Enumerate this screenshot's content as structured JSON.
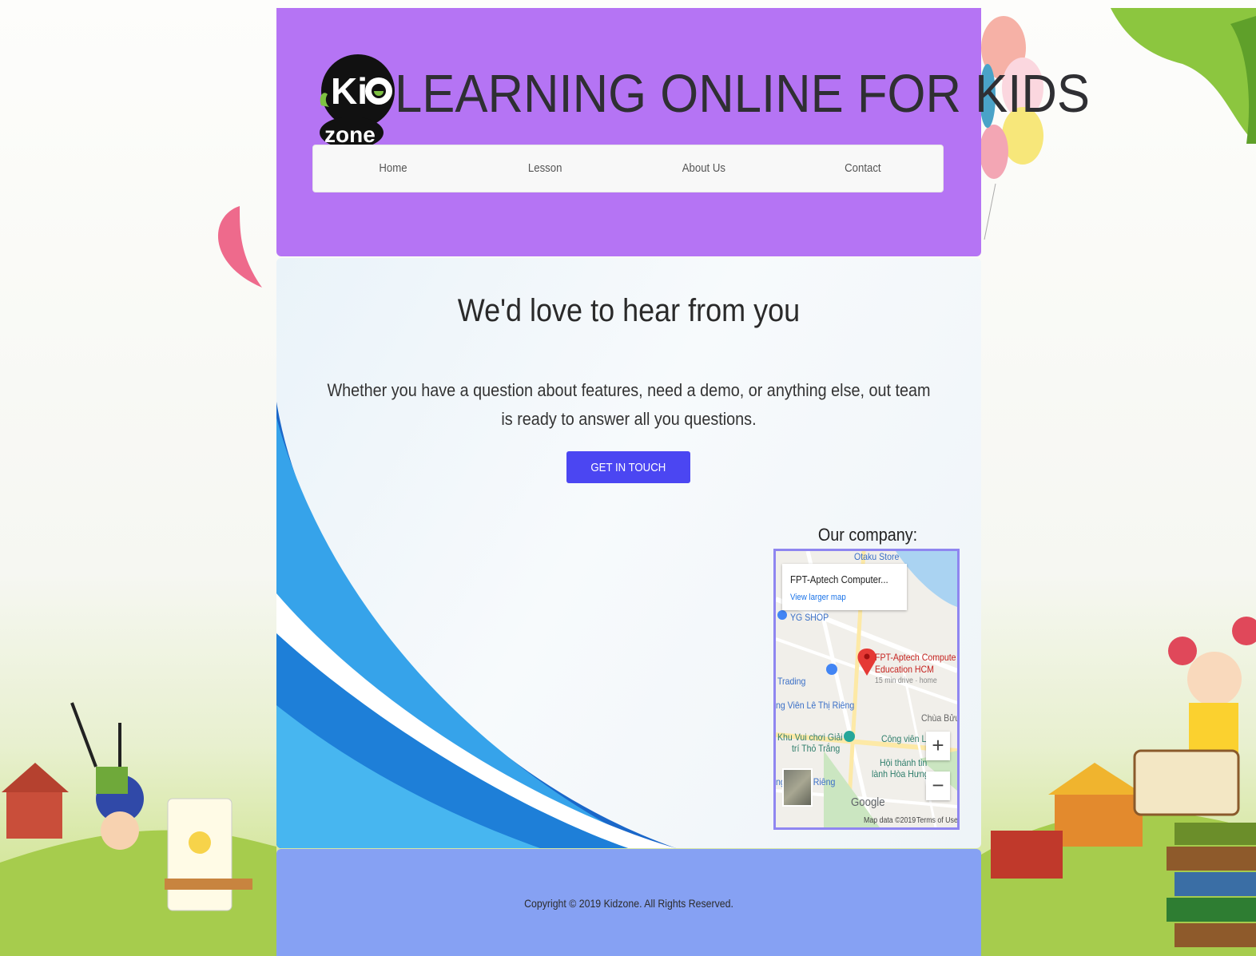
{
  "site": {
    "logo_text_top": "Kid",
    "logo_text_bottom": "zone",
    "title": "LEARNING ONLINE FOR KIDS"
  },
  "nav": {
    "items": [
      {
        "label": "Home"
      },
      {
        "label": "Lesson"
      },
      {
        "label": "About Us"
      },
      {
        "label": "Contact"
      }
    ]
  },
  "contact": {
    "heading": "We'd love to hear from you",
    "lead": "Whether you have a question about features, need a demo, or anything else, out team is ready to answer all you questions.",
    "cta_label": "GET IN TOUCH",
    "company_label": "Our company:"
  },
  "map": {
    "card_title": "FPT-Aptech Computer...",
    "card_link": "View larger map",
    "labels": {
      "otaku": "Otaku Store",
      "yg_shop": "YG SHOP",
      "fpt_line1": "FPT-Aptech Compute",
      "fpt_line2": "Education HCM",
      "fpt_drive": "15 min drive · home",
      "trading": "Trading",
      "le_thi_rieng_1": "ng Viên Lê Thị Riêng",
      "chua_buu": "Chùa Bửu",
      "khu_vui_1": "Khu Vui chơi Giải",
      "khu_vui_2": "trí Thỏ Trắng",
      "cong_vien": "Công viên L",
      "hoi_thanh_1": "Hội thánh tin",
      "hoi_thanh_2": "lành Hòa Hưng",
      "le_thi_rieng_2": "ng Lê Thị Riêng",
      "google": "Google",
      "attribution": "Map data ©2019",
      "terms": "Terms of Use"
    },
    "zoom_in": "+",
    "zoom_out": "−",
    "colors": {
      "pin": "#e53935",
      "water": "#aad3f2",
      "accent_label": "#c5221f"
    }
  },
  "footer": {
    "copyright": "Copyright © 2019 Kidzone. All Rights Reserved."
  },
  "colors": {
    "header_bg": "#b574f4",
    "footer_bg": "#86a1f3",
    "cta_bg": "#4b46f2"
  }
}
